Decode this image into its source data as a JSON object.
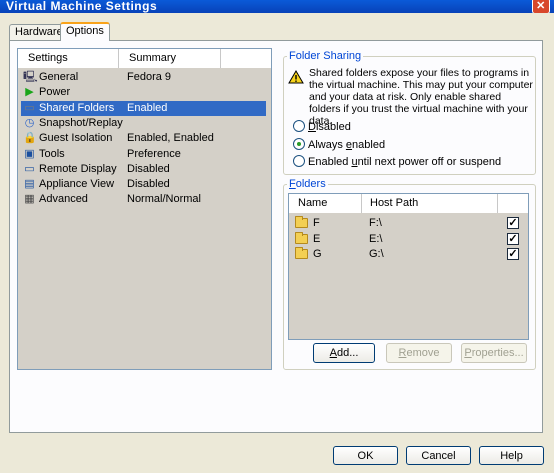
{
  "window": {
    "title": "Virtual Machine Settings",
    "close_symbol": "✕"
  },
  "tabs": [
    {
      "label": "Hardware"
    },
    {
      "label": "Options"
    }
  ],
  "settings_list": {
    "columns": {
      "settings": "Settings",
      "summary": "Summary"
    },
    "rows": [
      {
        "name": "General",
        "summary": "Fedora 9",
        "icon": "general-icon"
      },
      {
        "name": "Power",
        "summary": "",
        "icon": "power-icon"
      },
      {
        "name": "Shared Folders",
        "summary": "Enabled",
        "icon": "shared-folders-icon"
      },
      {
        "name": "Snapshot/Replay",
        "summary": "",
        "icon": "snapshot-icon"
      },
      {
        "name": "Guest Isolation",
        "summary": "Enabled, Enabled",
        "icon": "lock-icon"
      },
      {
        "name": "Tools",
        "summary": "Preference",
        "icon": "tools-icon"
      },
      {
        "name": "Remote Display",
        "summary": "Disabled",
        "icon": "monitor-icon"
      },
      {
        "name": "Appliance View",
        "summary": "Disabled",
        "icon": "appliance-icon"
      },
      {
        "name": "Advanced",
        "summary": "Normal/Normal",
        "icon": "advanced-icon"
      }
    ],
    "selected": "Shared Folders"
  },
  "folder_sharing": {
    "legend": "Folder Sharing",
    "info": "Shared folders expose your files to programs in the virtual machine. This may put your computer and your data at risk. Only enable shared folders if you trust the virtual machine with your data.",
    "options": [
      {
        "pre": "",
        "acc": "D",
        "post": "isabled",
        "checked": false
      },
      {
        "pre": "Always ",
        "acc": "e",
        "post": "nabled",
        "checked": true
      },
      {
        "pre": "Enabled ",
        "acc": "u",
        "post": "ntil next power off or suspend",
        "checked": false
      }
    ]
  },
  "folders": {
    "legend_acc": "F",
    "legend_rest": "olders",
    "columns": {
      "name": "Name",
      "host_path": "Host Path"
    },
    "rows": [
      {
        "name": "F",
        "host_path": "F:\\",
        "enabled": true
      },
      {
        "name": "E",
        "host_path": "E:\\",
        "enabled": true
      },
      {
        "name": "G",
        "host_path": "G:\\",
        "enabled": true
      }
    ],
    "check_mark": "✓",
    "buttons": {
      "add": {
        "acc": "A",
        "rest": "dd..."
      },
      "remove": {
        "acc": "R",
        "rest": "emove"
      },
      "properties": {
        "acc": "P",
        "rest": "roperties..."
      }
    }
  },
  "footer": {
    "ok": "OK",
    "cancel": "Cancel",
    "help": "Help"
  }
}
